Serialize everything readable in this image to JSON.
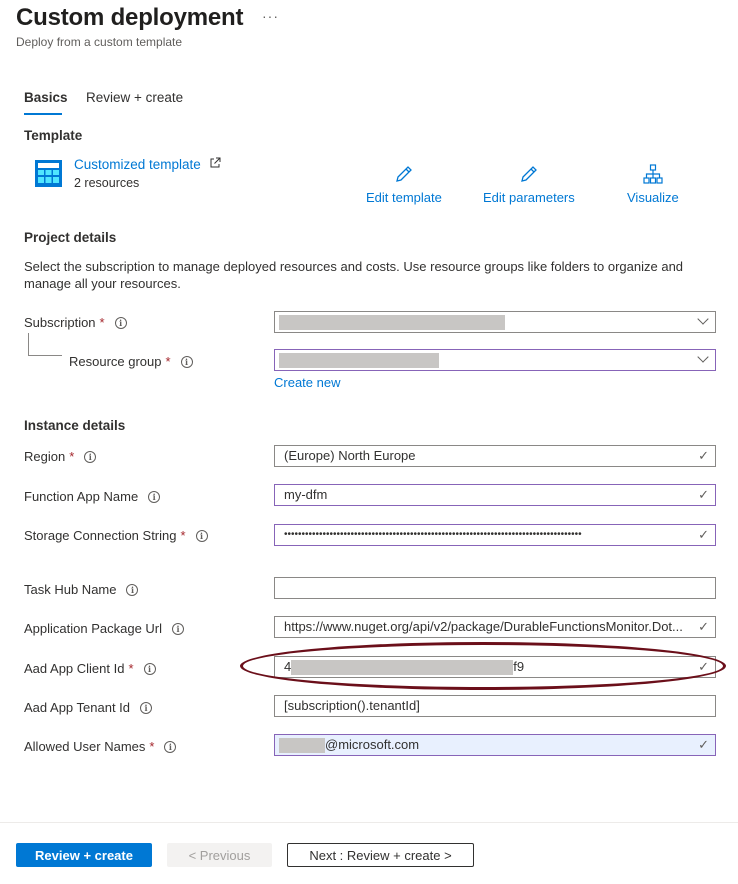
{
  "header": {
    "title": "Custom deployment",
    "more_label": "···",
    "subtitle": "Deploy from a custom template"
  },
  "tabs": [
    {
      "label": "Basics",
      "active": true
    },
    {
      "label": "Review + create",
      "active": false
    }
  ],
  "template": {
    "heading": "Template",
    "link_label": "Customized template",
    "resource_count": "2 resources",
    "actions": [
      {
        "label": "Edit template",
        "icon": "pencil-icon"
      },
      {
        "label": "Edit parameters",
        "icon": "pencil-icon"
      },
      {
        "label": "Visualize",
        "icon": "hierarchy-icon"
      }
    ]
  },
  "project": {
    "heading": "Project details",
    "description": "Select the subscription to manage deployed resources and costs. Use resource groups like folders to organize and manage all your resources.",
    "subscription_label": "Subscription",
    "resource_group_label": "Resource group",
    "create_new_label": "Create new"
  },
  "instance": {
    "heading": "Instance details",
    "region_label": "Region",
    "region_value": "(Europe) North Europe",
    "function_app_name_label": "Function App Name",
    "function_app_name_value": "my-dfm",
    "storage_conn_label": "Storage Connection String",
    "storage_conn_value": "•••••••••••••••••••••••••••••••••••••••••••••••••••••••••••••••••••••••••••••••••••••",
    "task_hub_label": "Task Hub Name",
    "task_hub_value": "",
    "package_url_label": "Application Package Url",
    "package_url_value": "https://www.nuget.org/api/v2/package/DurableFunctionsMonitor.Dot...",
    "client_id_label": "Aad App Client Id",
    "client_id_prefix": "4",
    "client_id_suffix": "f9",
    "tenant_id_label": "Aad App Tenant Id",
    "tenant_id_value": "[subscription().tenantId]",
    "user_names_label": "Allowed User Names",
    "user_names_suffix": "@microsoft.com"
  },
  "footer": {
    "review_create_label": "Review + create",
    "previous_label": "< Previous",
    "next_label": "Next : Review + create >"
  },
  "colors": {
    "accent": "#0078d4",
    "required": "#a4262c",
    "annotation": "#6b0f1a"
  }
}
